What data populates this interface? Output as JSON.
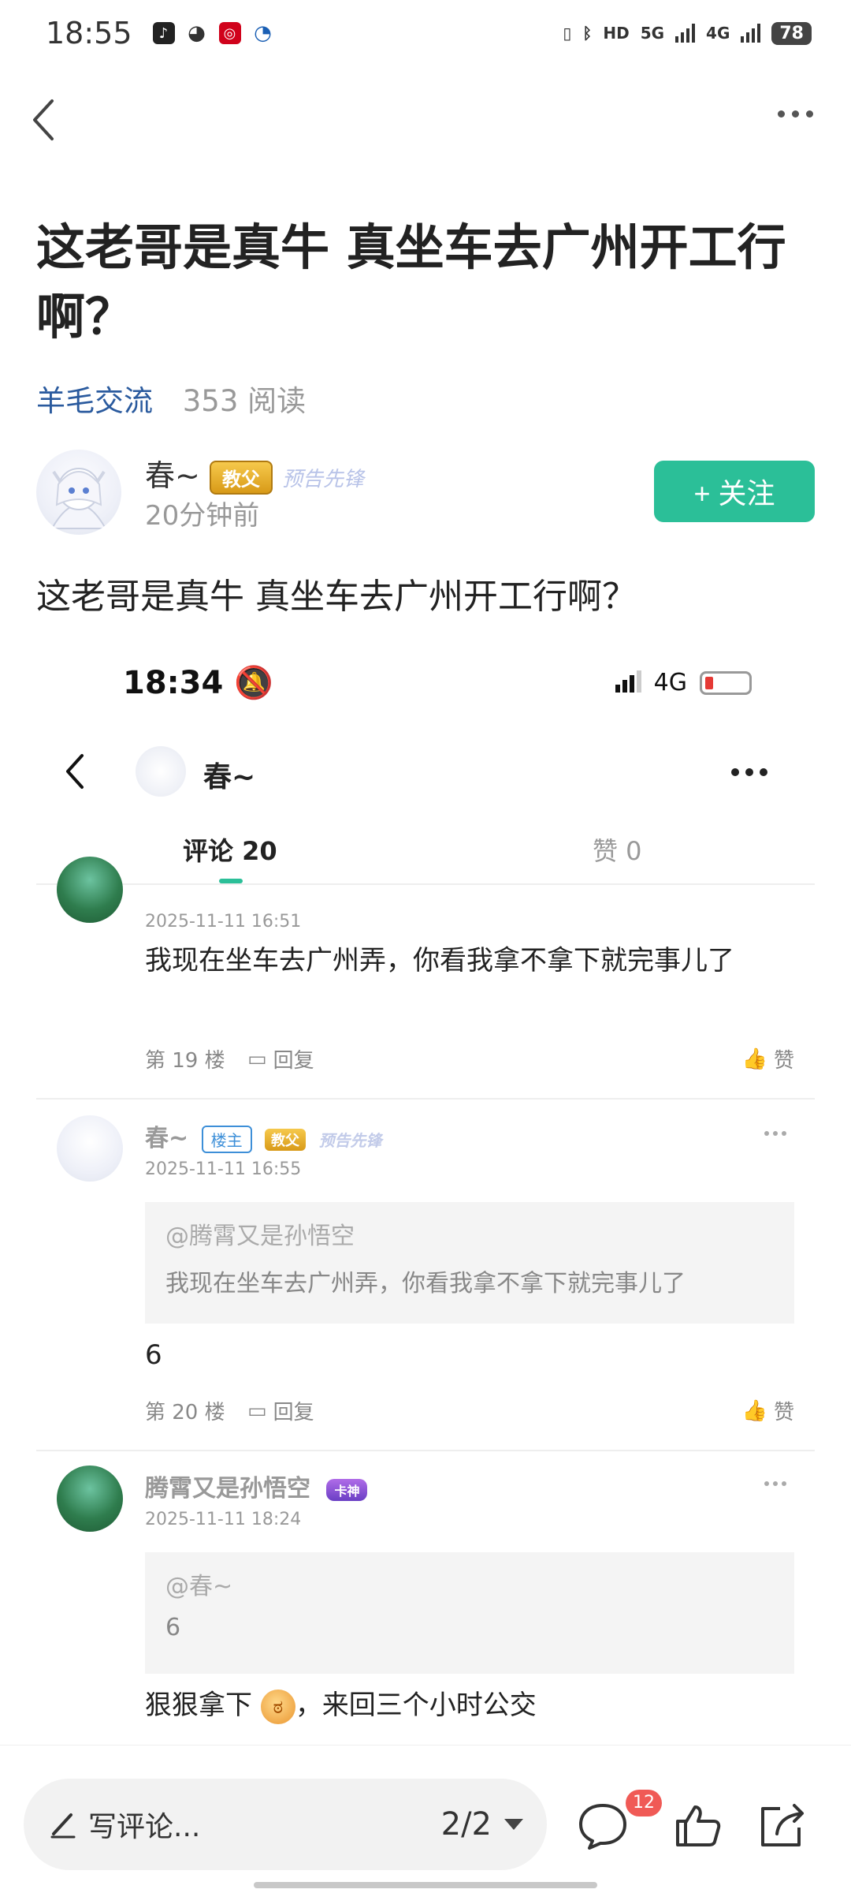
{
  "status_bar": {
    "time": "18:55",
    "network1": "5G",
    "network2": "4G",
    "battery": "78",
    "hd": "HD"
  },
  "post": {
    "title": "这老哥是真牛 真坐车去广州开工行啊？",
    "category": "羊毛交流",
    "reads": "353 阅读",
    "author": {
      "name": "春~",
      "badge": "教父",
      "badge2": "预告先锋",
      "time": "20分钟前"
    },
    "follow_label": "+ 关注",
    "body": "这老哥是真牛 真坐车去广州开工行啊？"
  },
  "screenshot": {
    "time": "18:34",
    "network": "4G",
    "user": "春~",
    "tabs": {
      "comments": "评论 20",
      "likes": "赞 0"
    },
    "comments": [
      {
        "date": "2025-11-11 16:51",
        "text": "我现在坐车去广州弄，你看我拿不拿下就完事儿了",
        "floor": "第 19 楼",
        "reply": "回复",
        "like": "赞"
      },
      {
        "name": "春~",
        "owner_tag": "楼主",
        "badge": "教父",
        "badge2": "预告先锋",
        "date": "2025-11-11 16:55",
        "quote_at": "@腾霄又是孙悟空",
        "quote_text": "我现在坐车去广州弄，你看我拿不拿下就完事儿了",
        "text": "6",
        "floor": "第 20 楼",
        "reply": "回复",
        "like": "赞"
      },
      {
        "name": "腾霄又是孙悟空",
        "badge": "卡神",
        "date": "2025-11-11 18:24",
        "quote_at": "@春~",
        "quote_text": "6",
        "text_before": "狠狠拿下",
        "text_after": "，来回三个小时公交"
      }
    ]
  },
  "bottom_bar": {
    "placeholder": "写评论...",
    "page": "2/2",
    "comment_count": "12"
  }
}
